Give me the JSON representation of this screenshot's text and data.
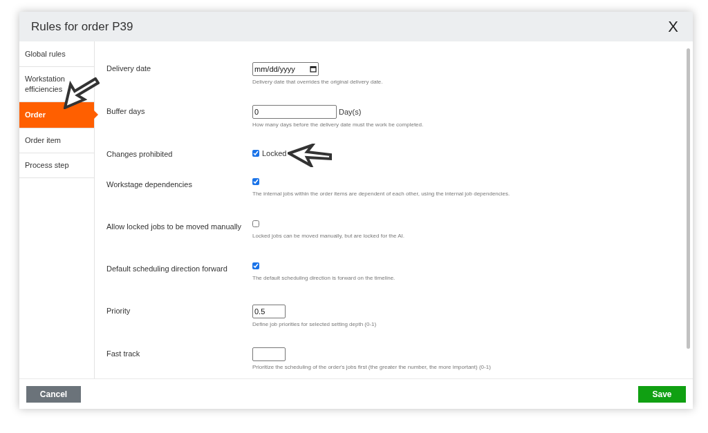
{
  "window": {
    "title": "Rules for order P39",
    "close": "X"
  },
  "sidebar": {
    "items": [
      {
        "label": "Global rules",
        "selected": false
      },
      {
        "label": "Workstation efficiencies",
        "selected": false
      },
      {
        "label": "Order",
        "selected": true
      },
      {
        "label": "Order item",
        "selected": false
      },
      {
        "label": "Process step",
        "selected": false
      }
    ]
  },
  "settings": [
    {
      "kind": "date",
      "label": "Delivery date",
      "value": "mm/dd/yyyy",
      "description": "Delivery date that overrides the original delivery date."
    },
    {
      "kind": "number",
      "label": "Buffer days",
      "value": "0",
      "unit": "Day(s)",
      "description": "How many days before the delivery date must the work be completed."
    },
    {
      "kind": "checkbox",
      "label": "Changes prohibited",
      "checked": true,
      "checkbox_label": "Locked"
    },
    {
      "kind": "checkbox",
      "label": "Workstage dependencies",
      "checked": true,
      "description": "The internal jobs within the order items are dependent of each other, using the internal job dependencies."
    },
    {
      "kind": "checkbox",
      "label": "Allow locked jobs to be moved manually",
      "checked": false,
      "description": "Locked jobs can be moved manually, but are locked for the AI."
    },
    {
      "kind": "checkbox",
      "label": "Default scheduling direction forward",
      "checked": true,
      "description": "The default scheduling direction is forward on the timeline."
    },
    {
      "kind": "small",
      "label": "Priority",
      "value": "0.5",
      "description": "Define job priorities for selected setting depth (0-1)"
    },
    {
      "kind": "small",
      "label": "Fast track",
      "description": "Prioritize the scheduling of the order's jobs first (the greater the number, the more important) (0-1)"
    }
  ],
  "buttons": {
    "cancel": "Cancel",
    "save": "Save"
  }
}
